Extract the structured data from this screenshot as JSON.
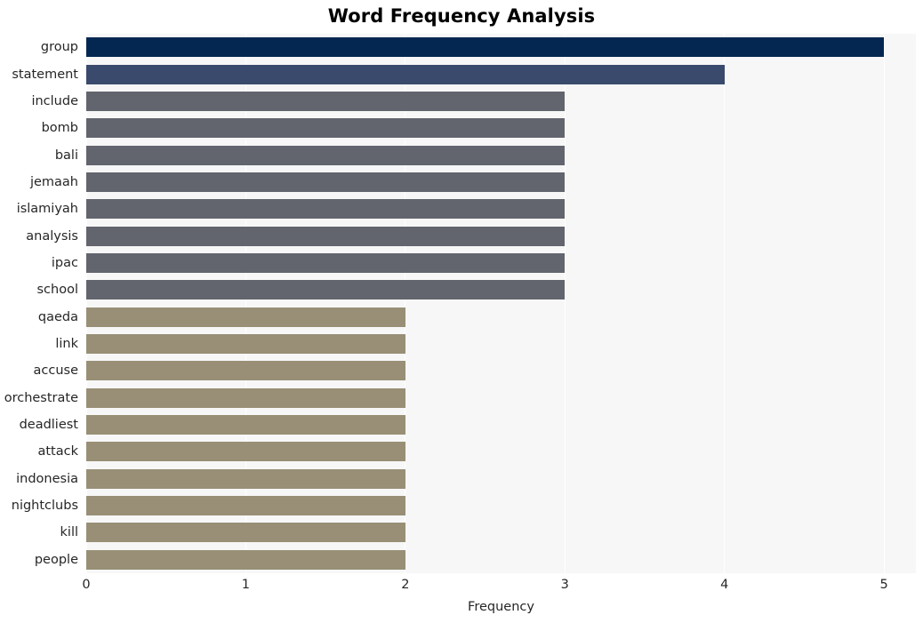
{
  "chart_data": {
    "type": "bar",
    "orientation": "horizontal",
    "title": "Word Frequency Analysis",
    "xlabel": "Frequency",
    "ylabel": "",
    "xlim": [
      0,
      5.2
    ],
    "xticks": [
      "0",
      "1",
      "2",
      "3",
      "4",
      "5"
    ],
    "xtick_values": [
      0,
      1,
      2,
      3,
      4,
      5
    ],
    "grid": true,
    "legend": null,
    "categories": [
      "group",
      "statement",
      "include",
      "bomb",
      "bali",
      "jemaah",
      "islamiyah",
      "analysis",
      "ipac",
      "school",
      "qaeda",
      "link",
      "accuse",
      "orchestrate",
      "deadliest",
      "attack",
      "indonesia",
      "nightclubs",
      "kill",
      "people"
    ],
    "values": [
      5,
      4,
      3,
      3,
      3,
      3,
      3,
      3,
      3,
      3,
      2,
      2,
      2,
      2,
      2,
      2,
      2,
      2,
      2,
      2
    ],
    "bar_colors": [
      "#042751",
      "#3a4a6d",
      "#62656d",
      "#62656d",
      "#62656d",
      "#62656d",
      "#62656d",
      "#62656d",
      "#62656d",
      "#62656d",
      "#988f76",
      "#988f76",
      "#988f76",
      "#988f76",
      "#988f76",
      "#988f76",
      "#988f76",
      "#988f76",
      "#988f76",
      "#988f76"
    ]
  },
  "style": {
    "figure_background": "#ffffff",
    "axes_background": "#f7f7f7",
    "gridline_color": "#ffffff",
    "text_color": "#262626",
    "title_color": "#000000"
  }
}
